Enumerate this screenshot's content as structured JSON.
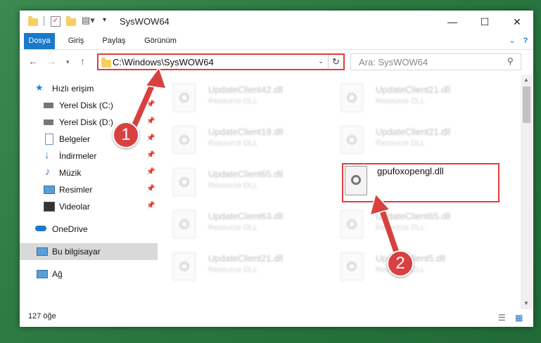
{
  "window": {
    "title": "SysWOW64",
    "minimize": "—",
    "maximize": "☐",
    "close": "✕"
  },
  "ribbon": {
    "tabs": [
      "Dosya",
      "Giriş",
      "Paylaş",
      "Görünüm"
    ],
    "help": "?"
  },
  "address": {
    "path": "C:\\Windows\\SysWOW64"
  },
  "search": {
    "placeholder": "Ara: SysWOW64"
  },
  "nav": {
    "quick_access": "Hızlı erişim",
    "items": [
      "Yerel Disk (C:)",
      "Yerel Disk (D:)",
      "Belgeler",
      "İndirmeler",
      "Müzik",
      "Resimler",
      "Videolar"
    ],
    "onedrive": "OneDrive",
    "this_pc": "Bu bilgisayar",
    "network": "Ağ"
  },
  "files": [
    {
      "name": "UpdateClient42.dll",
      "sub": "Resource DLL"
    },
    {
      "name": "UpdateClient21.dll",
      "sub": "Resource DLL"
    },
    {
      "name": "UpdateClient19.dll",
      "sub": "Resource DLL"
    },
    {
      "name": "UpdateClient21.dll",
      "sub": "Resource DLL"
    },
    {
      "name": "UpdateClient65.dll",
      "sub": "Resource DLL"
    },
    {
      "name": "gpufoxopengl.dll",
      "sub": ""
    },
    {
      "name": "UpdateClient63.dll",
      "sub": "Resource DLL"
    },
    {
      "name": "UpdateClient65.dll",
      "sub": "Resource DLL"
    },
    {
      "name": "UpdateClient21.dll",
      "sub": "Resource DLL"
    },
    {
      "name": "UpdateClient5.dll",
      "sub": "Resource DLL"
    }
  ],
  "status": {
    "count": "127 öğe"
  },
  "annotations": {
    "step1": "1",
    "step2": "2"
  },
  "colors": {
    "accent": "#1979ca",
    "highlight": "#e53b3b",
    "badge": "#d94040"
  }
}
